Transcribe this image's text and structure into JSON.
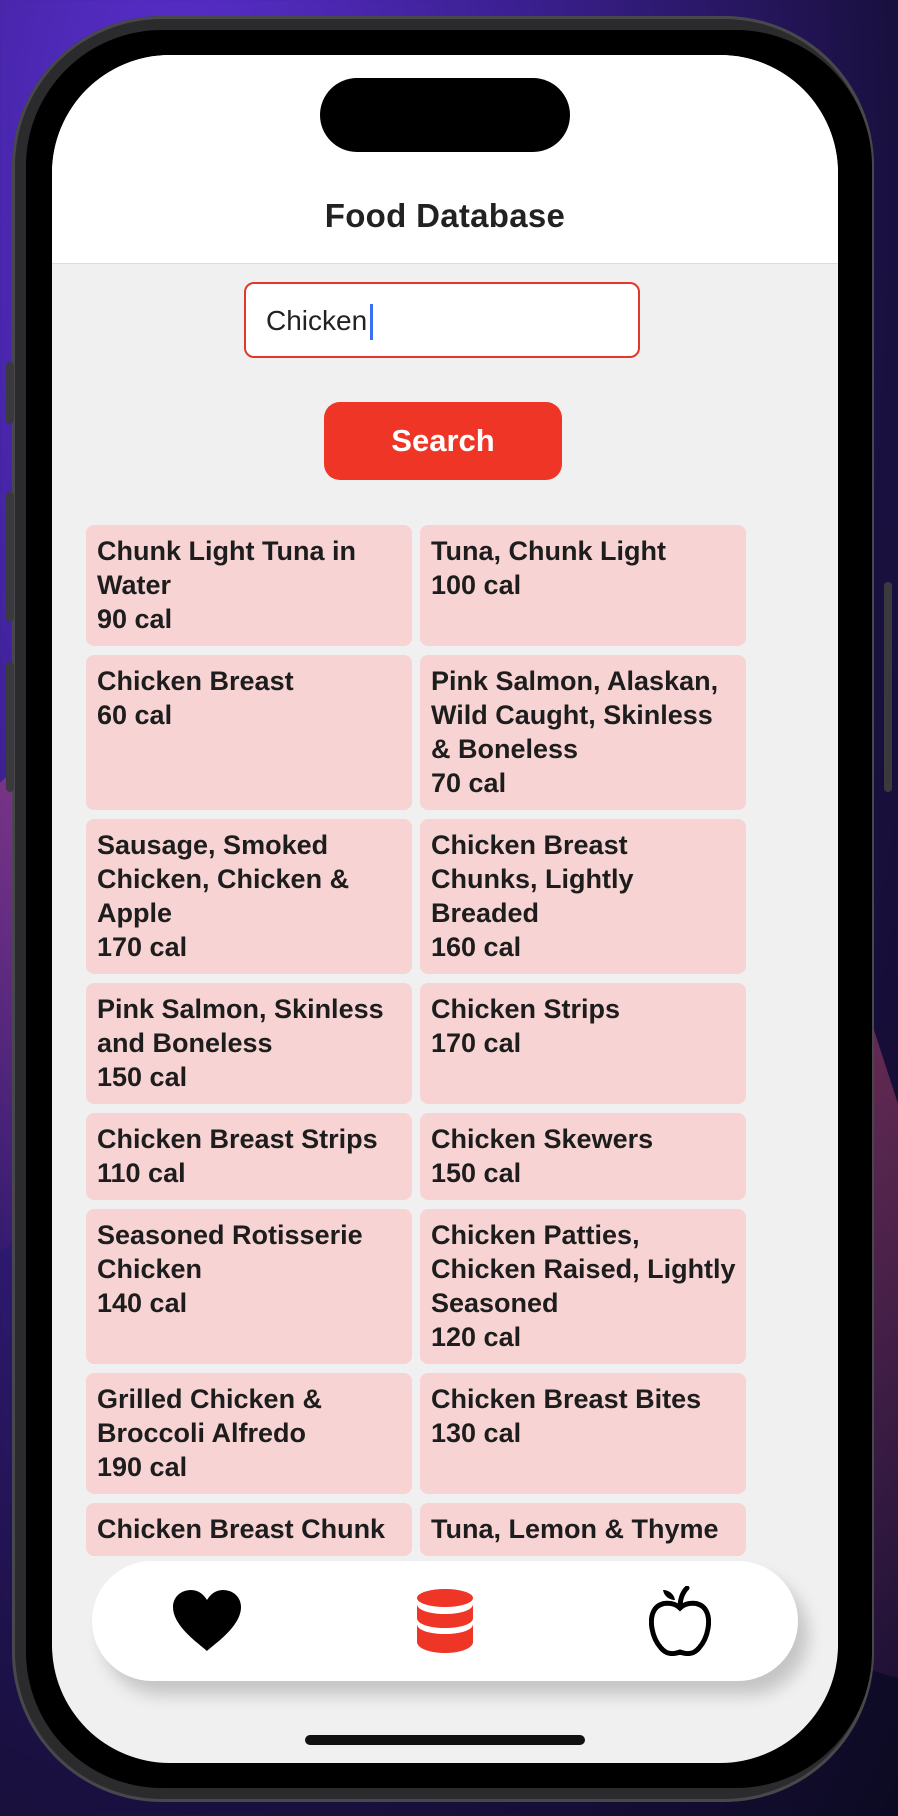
{
  "header": {
    "title": "Food Database"
  },
  "search": {
    "value": "Chicken",
    "button_label": "Search"
  },
  "results": [
    {
      "name": "Chunk Light Tuna in Water",
      "calories": "90 cal"
    },
    {
      "name": "Tuna, Chunk Light",
      "calories": "100 cal"
    },
    {
      "name": "Chicken Breast",
      "calories": "60 cal"
    },
    {
      "name": "Pink Salmon, Alaskan, Wild Caught, Skinless & Boneless",
      "calories": "70 cal"
    },
    {
      "name": "Sausage, Smoked Chicken, Chicken & Apple",
      "calories": "170 cal"
    },
    {
      "name": "Chicken Breast Chunks, Lightly Breaded",
      "calories": "160 cal"
    },
    {
      "name": "Pink Salmon, Skinless and Boneless",
      "calories": "150 cal"
    },
    {
      "name": "Chicken Strips",
      "calories": "170 cal"
    },
    {
      "name": "Chicken Breast Strips",
      "calories": "110 cal"
    },
    {
      "name": "Chicken Skewers",
      "calories": "150 cal"
    },
    {
      "name": "Seasoned Rotisserie Chicken",
      "calories": "140 cal"
    },
    {
      "name": "Chicken Patties, Chicken Raised, Lightly Seasoned",
      "calories": "120 cal"
    },
    {
      "name": "Grilled Chicken & Broccoli Alfredo",
      "calories": "190 cal"
    },
    {
      "name": "Chicken Breast Bites",
      "calories": "130 cal"
    },
    {
      "name": "Chicken Breast Chunk",
      "calories": ""
    },
    {
      "name": "Tuna, Lemon & Thyme",
      "calories": ""
    }
  ],
  "tab_bar": {
    "items": [
      {
        "icon": "heart-icon",
        "active": false
      },
      {
        "icon": "database-icon",
        "active": true
      },
      {
        "icon": "apple-icon",
        "active": false
      }
    ],
    "active_color": "#ee3526",
    "inactive_color": "#000000"
  },
  "colors": {
    "accent": "#ee3526",
    "card_background": "#f7d4d3",
    "screen_background": "#f0f0f0"
  }
}
